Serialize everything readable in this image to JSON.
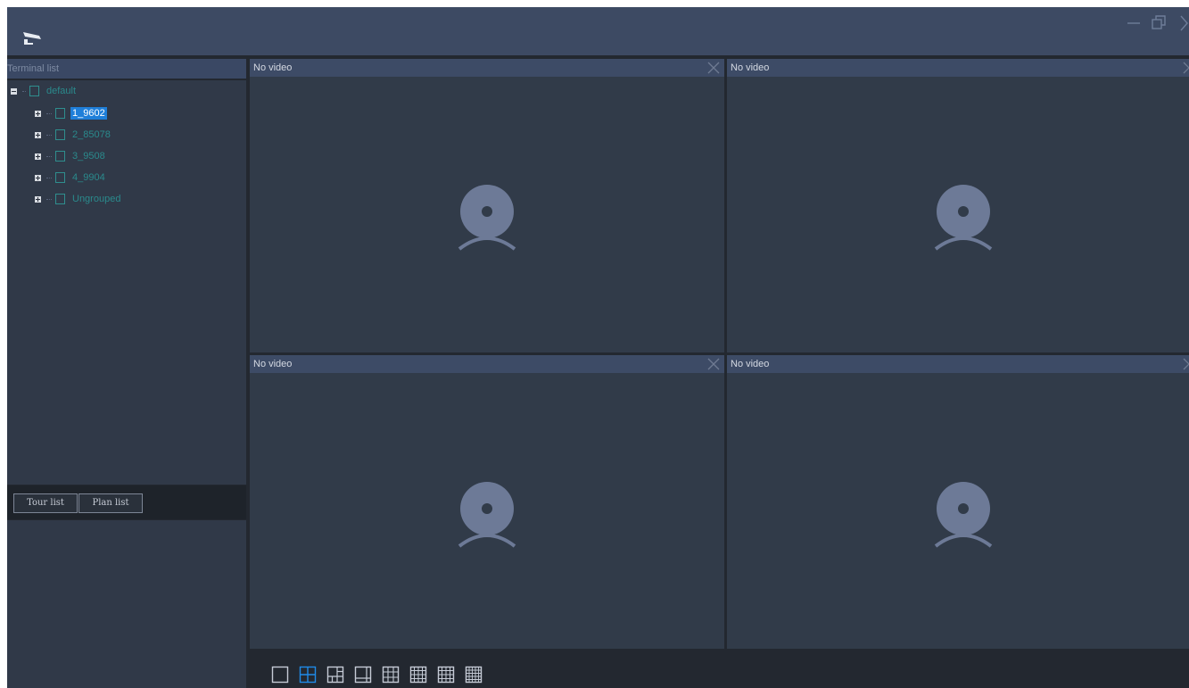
{
  "app": {
    "logo_icon": "camera-logo-icon",
    "window_controls": [
      "minimize-icon",
      "restore-icon",
      "close-icon"
    ]
  },
  "sidebar": {
    "terminal_list_title": "Terminal list",
    "tree": {
      "root": {
        "label": "default",
        "expanded": true
      },
      "children": [
        {
          "label": "1_9602",
          "selected": true
        },
        {
          "label": "2_85078",
          "selected": false
        },
        {
          "label": "3_9508",
          "selected": false
        },
        {
          "label": "4_9904",
          "selected": false
        },
        {
          "label": "Ungrouped",
          "selected": false
        }
      ]
    },
    "tabs": [
      {
        "label": "Tour list",
        "active": true
      },
      {
        "label": "Plan list",
        "active": false
      }
    ]
  },
  "video_grid": {
    "layout": "2x2",
    "cells": [
      {
        "title": "No video"
      },
      {
        "title": "No video"
      },
      {
        "title": "No video"
      },
      {
        "title": "No video"
      }
    ]
  },
  "layout_bar": {
    "options": [
      "1",
      "4",
      "6",
      "8",
      "9",
      "13",
      "16",
      "25"
    ],
    "active": "4"
  },
  "colors": {
    "titlebar": "#3d4a63",
    "panel": "#303948",
    "cell": "#313b49",
    "cell_header": "#3d4b66",
    "selection": "#1f7fd9",
    "tree_text": "#2a8a8c",
    "active_layout": "#1f8ae8"
  }
}
